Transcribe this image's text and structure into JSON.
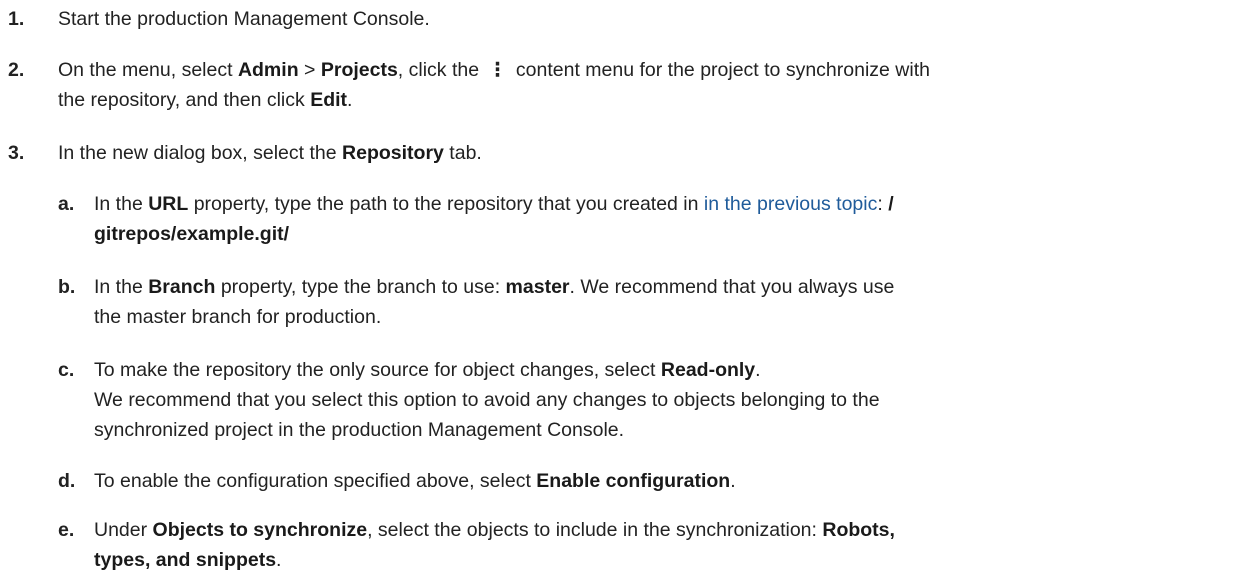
{
  "steps": [
    {
      "number": "1.",
      "text": "Start the production Management Console."
    },
    {
      "number": "2.",
      "t1": "On the menu, select ",
      "b1": "Admin",
      "t2": " > ",
      "b2": "Projects",
      "t3": ", click the ",
      "icon": "⋮",
      "t4": " content menu for the project to synchronize with",
      "line2_t1": "the repository, and then click ",
      "b3": "Edit",
      "t5": "."
    },
    {
      "number": "3.",
      "t1": "In the new dialog box, select the ",
      "b1": "Repository",
      "t2": " tab."
    }
  ],
  "substeps": [
    {
      "letter": "a.",
      "t1": "In the ",
      "b1": "URL",
      "t2": " property, type the path to the repository that you created in ",
      "link": "in the previous topic",
      "t3": ": ",
      "b2": "/",
      "line2_b": "gitrepos/example.git/"
    },
    {
      "letter": "b.",
      "t1": "In the ",
      "b1": "Branch",
      "t2": " property, type the branch to use: ",
      "b2": "master",
      "t3": ". We recommend that you always use",
      "line2": "the master branch for production."
    },
    {
      "letter": "c.",
      "t1": "To make the repository the only source for object changes, select ",
      "b1": "Read-only",
      "t2": ".",
      "p2_line1": "We recommend that you select this option to avoid any changes to objects belonging to the",
      "p2_line2": "synchronized project in the production Management Console."
    },
    {
      "letter": "d.",
      "t1": "To enable the configuration specified above, select ",
      "b1": "Enable configuration",
      "t2": "."
    },
    {
      "letter": "e.",
      "t1": "Under ",
      "b1": "Objects to synchronize",
      "t2": ", select the objects to include in the synchronization: ",
      "b2": "Robots,",
      "line2_b": "types, and snippets",
      "t3": "."
    }
  ]
}
